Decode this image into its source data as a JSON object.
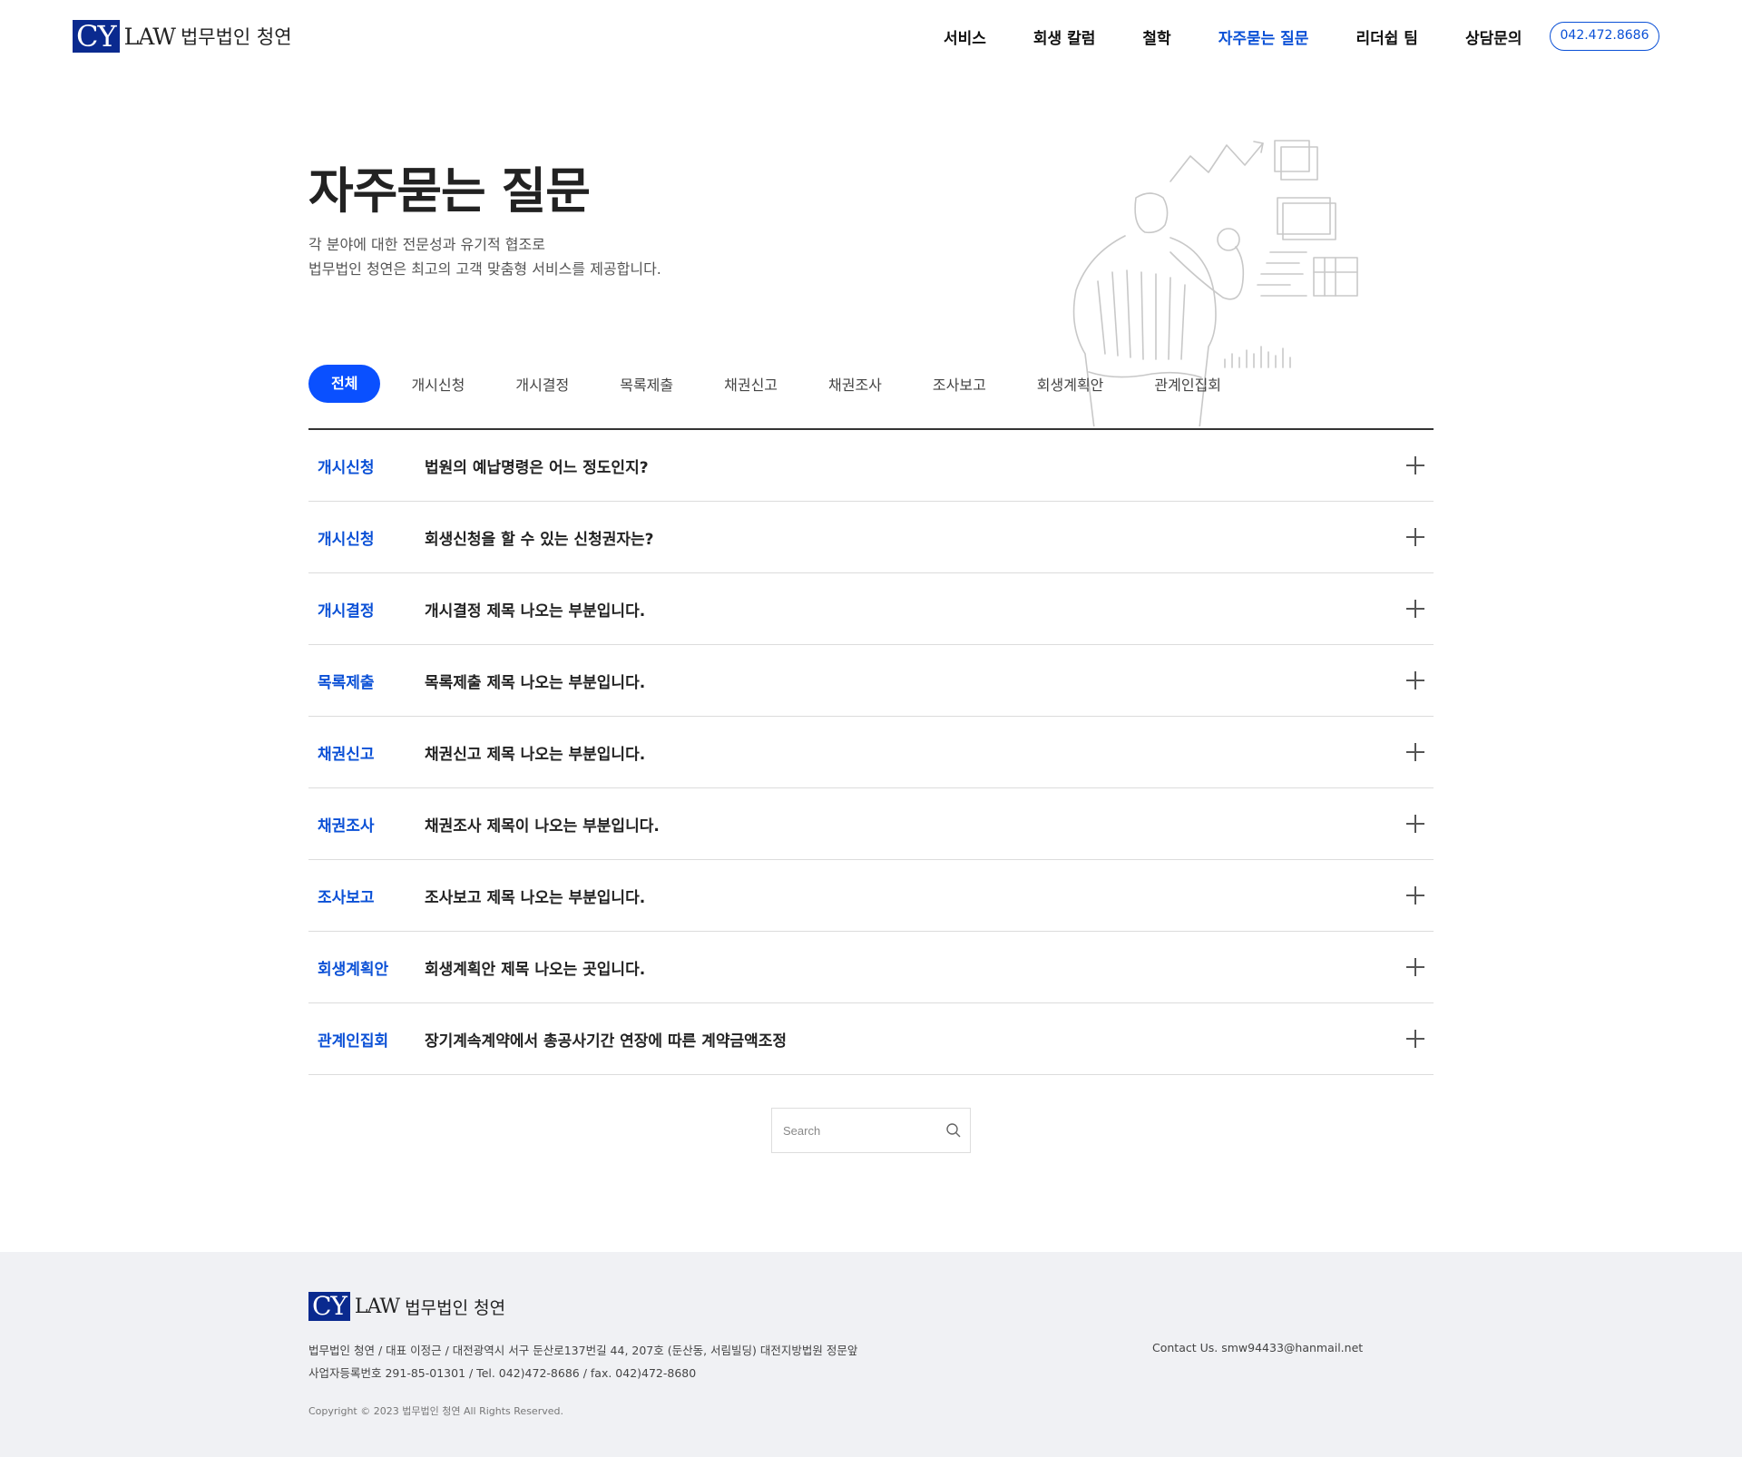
{
  "header": {
    "logo_mark": "CY",
    "logo_law": "LAW",
    "logo_name": "법무법인 청연",
    "nav": [
      {
        "label": "서비스",
        "active": false
      },
      {
        "label": "회생 칼럼",
        "active": false
      },
      {
        "label": "철학",
        "active": false
      },
      {
        "label": "자주묻는 질문",
        "active": true
      },
      {
        "label": "리더쉽 팀",
        "active": false
      },
      {
        "label": "상담문의",
        "active": false
      }
    ],
    "phone": "042.472.8686"
  },
  "hero": {
    "title": "자주묻는 질문",
    "desc_line1": "각 분야에 대한 전문성과 유기적 협조로",
    "desc_line2": "법무법인 청연은 최고의 고객 맞춤형 서비스를 제공합니다."
  },
  "tabs": [
    {
      "label": "전체",
      "active": true
    },
    {
      "label": "개시신청",
      "active": false
    },
    {
      "label": "개시결정",
      "active": false
    },
    {
      "label": "목록제출",
      "active": false
    },
    {
      "label": "채권신고",
      "active": false
    },
    {
      "label": "채권조사",
      "active": false
    },
    {
      "label": "조사보고",
      "active": false
    },
    {
      "label": "회생계획안",
      "active": false
    },
    {
      "label": "관계인집회",
      "active": false
    }
  ],
  "faq": [
    {
      "category": "개시신청",
      "question": "법원의 예납명령은 어느 정도인지?"
    },
    {
      "category": "개시신청",
      "question": "회생신청을 할 수 있는 신청권자는?"
    },
    {
      "category": "개시결정",
      "question": "개시결정 제목 나오는 부분입니다."
    },
    {
      "category": "목록제출",
      "question": "목록제출 제목 나오는 부분입니다."
    },
    {
      "category": "채권신고",
      "question": "채권신고 제목 나오는 부분입니다."
    },
    {
      "category": "채권조사",
      "question": "채권조사 제목이 나오는 부분입니다."
    },
    {
      "category": "조사보고",
      "question": "조사보고 제목 나오는 부분입니다."
    },
    {
      "category": "회생계획안",
      "question": "회생계획안 제목 나오는 곳입니다."
    },
    {
      "category": "관계인집회",
      "question": "장기계속계약에서 총공사기간 연장에 따른 계약금액조정"
    }
  ],
  "search": {
    "placeholder": "Search",
    "value": ""
  },
  "footer": {
    "logo_mark": "CY",
    "logo_law": "LAW",
    "logo_name": "법무법인 청연",
    "address": "법무법인 청연 / 대표 이정근 / 대전광역시 서구 둔산로137번길 44, 207호 (둔산동, 서림빌딩) 대전지방법원 정문앞",
    "biz_info": "사업자등록번호 291-85-01301 / Tel. 042)472-8686 / fax. 042)472-8680",
    "contact": "Contact Us. smw94433@hanmail.net",
    "copyright": "Copyright © 2023 법무법인 청연 All Rights Reserved."
  },
  "colors": {
    "accent": "#0a50ff",
    "brand_navy": "#0a2a8f",
    "link_blue": "#0a50d6",
    "footer_bg": "#f0f1f4"
  }
}
